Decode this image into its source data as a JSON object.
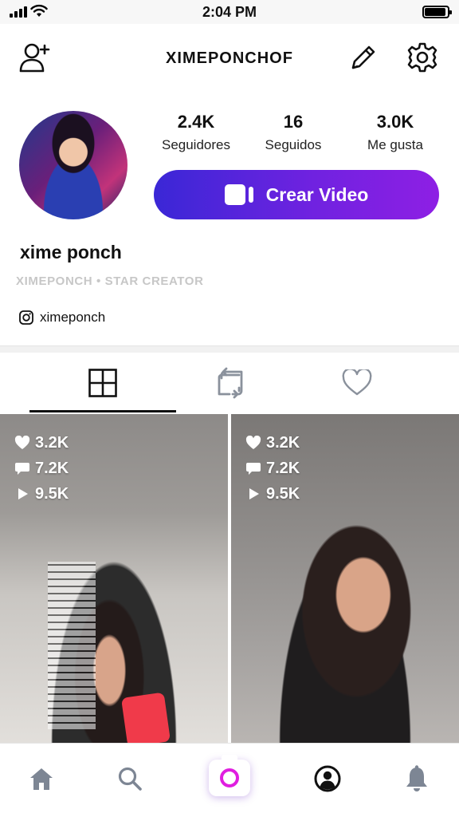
{
  "status_bar": {
    "time": "2:04 PM"
  },
  "header": {
    "username": "XIMEPONCHOF"
  },
  "profile": {
    "display_name": "xime ponch",
    "subtitle": "XIMEPONCH • STAR CREATOR",
    "instagram_handle": "ximeponch",
    "stats": [
      {
        "value": "2.4K",
        "label": "Seguidores"
      },
      {
        "value": "16",
        "label": "Seguidos"
      },
      {
        "value": "3.0K",
        "label": "Me gusta"
      }
    ],
    "create_button_label": "Crear Video"
  },
  "tabs": [
    {
      "icon": "grid-icon",
      "selected": true
    },
    {
      "icon": "repost-icon",
      "selected": false
    },
    {
      "icon": "heart-outline-icon",
      "selected": false
    }
  ],
  "videos": [
    {
      "likes": "3.2K",
      "comments": "7.2K",
      "views": "9.5K"
    },
    {
      "likes": "3.2K",
      "comments": "7.2K",
      "views": "9.5K"
    }
  ],
  "bottom_nav": [
    {
      "icon": "home-icon"
    },
    {
      "icon": "search-icon"
    },
    {
      "icon": "camera-icon"
    },
    {
      "icon": "profile-icon",
      "selected": true
    },
    {
      "icon": "bell-icon"
    }
  ],
  "colors": {
    "accent_start": "#3a27d6",
    "accent_end": "#8e1fe4",
    "camera_ring": "#e01ee0",
    "muted_text": "#c7c7c7",
    "nav_inactive": "#7d8694"
  }
}
